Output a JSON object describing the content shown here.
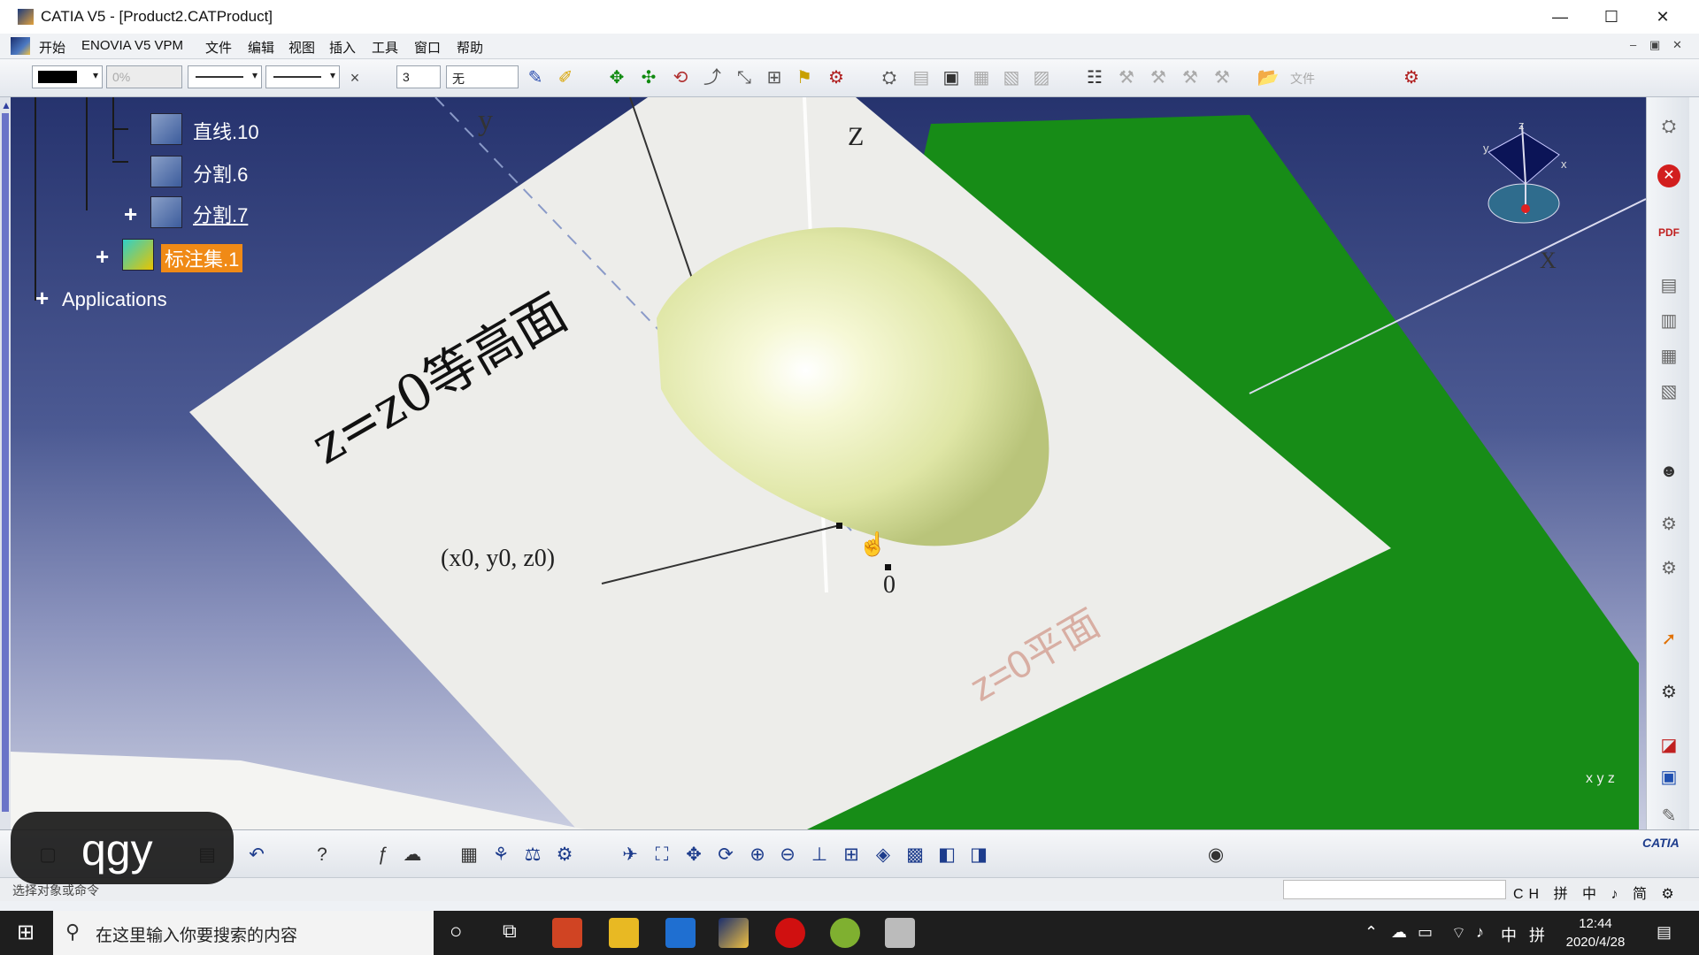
{
  "window": {
    "title": "CATIA V5 - [Product2.CATProduct]",
    "controls": {
      "minimize": "—",
      "maximize": "☐",
      "close": "✕"
    }
  },
  "menu": {
    "items": [
      "开始",
      "ENOVIA V5 VPM",
      "文件",
      "编辑",
      "视图",
      "插入",
      "工具",
      "窗口",
      "帮助"
    ],
    "mdi": {
      "minimize": "–",
      "restore": "▣",
      "close": "✕"
    }
  },
  "toolbar": {
    "color_value": "",
    "transparency": "0%",
    "layer_value": "无",
    "point_value": "3",
    "x_mark": "×",
    "file_label": "文件"
  },
  "tree": {
    "items": [
      {
        "label": "直线.10"
      },
      {
        "label": "分割.6"
      },
      {
        "label": "分割.7"
      },
      {
        "label": "标注集.1"
      },
      {
        "label": "Applications"
      }
    ]
  },
  "scene": {
    "axis_y": "y",
    "axis_z": "Z",
    "plane_text": "z=z0等高面",
    "point_label": "(x0, y0, z0)",
    "origin_label": "0",
    "ghost_text": "z=0平面",
    "compass": {
      "x": "x",
      "y": "y",
      "z": "z",
      "x_big": "X"
    },
    "axis_triad": "x  y  z",
    "colors": {
      "plane": "#ededea",
      "ground": "#178c17",
      "surface": "#e6ecb4",
      "bg_top": "#26336e",
      "bg_bottom": "#c9cde0"
    }
  },
  "status": {
    "prompt": "选择对象或命令",
    "ime": [
      "CH",
      "拼",
      "中",
      "♪",
      "简",
      "⚙"
    ]
  },
  "overlay_label": "qgy",
  "taskbar": {
    "search_placeholder": "在这里输入你要搜索的内容",
    "time": "12:44",
    "date": "2020/4/28",
    "tray_ime": "中",
    "tray_ime2": "拼"
  }
}
